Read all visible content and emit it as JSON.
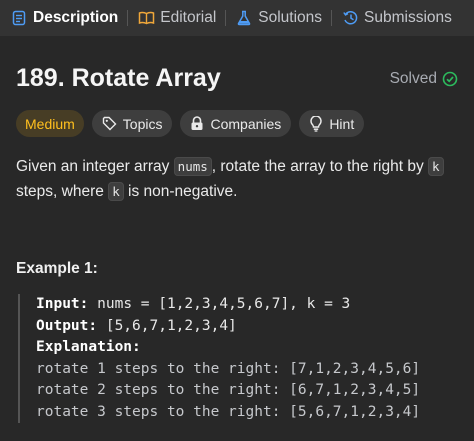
{
  "tabs": [
    {
      "label": "Description",
      "icon": "description-icon",
      "active": true
    },
    {
      "label": "Editorial",
      "icon": "book-icon",
      "active": false
    },
    {
      "label": "Solutions",
      "icon": "flask-icon",
      "active": false
    },
    {
      "label": "Submissions",
      "icon": "history-icon",
      "active": false
    }
  ],
  "problem": {
    "title": "189. Rotate Array",
    "status": "Solved",
    "status_color": "#2cbb5d"
  },
  "chips": {
    "difficulty": "Medium",
    "difficulty_color": "#ffc01e",
    "topics": "Topics",
    "companies": "Companies",
    "hint": "Hint"
  },
  "description": {
    "part1": "Given an integer array ",
    "code1": "nums",
    "part2": ", rotate the array to the right by ",
    "code2": "k",
    "part3": " steps, where ",
    "code3": "k",
    "part4": " is non-negative."
  },
  "example": {
    "title": "Example 1:",
    "input_label": "Input:",
    "input_value": "nums = [1,2,3,4,5,6,7], k = 3",
    "output_label": "Output:",
    "output_value": "[5,6,7,1,2,3,4]",
    "explanation_label": "Explanation:",
    "explanation_lines": [
      "rotate 1 steps to the right: [7,1,2,3,4,5,6]",
      "rotate 2 steps to the right: [6,7,1,2,3,4,5]",
      "rotate 3 steps to the right: [5,6,7,1,2,3,4]"
    ]
  }
}
